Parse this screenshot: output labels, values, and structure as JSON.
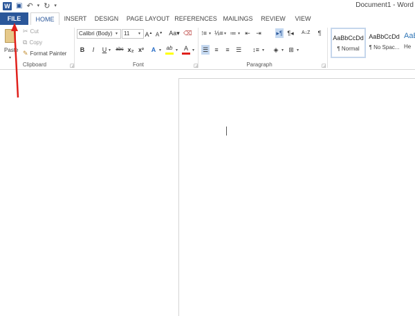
{
  "app": {
    "title": "Document1 - Word",
    "logo_letter": "W"
  },
  "quick_access": {
    "save": "💾",
    "undo": "↶",
    "undo_more": "▾",
    "redo": "↻",
    "customize": "▾"
  },
  "tabs": [
    {
      "label": "FILE",
      "key": "file"
    },
    {
      "label": "HOME",
      "key": "home"
    },
    {
      "label": "INSERT",
      "key": "insert"
    },
    {
      "label": "DESIGN",
      "key": "design"
    },
    {
      "label": "PAGE LAYOUT",
      "key": "page-layout"
    },
    {
      "label": "REFERENCES",
      "key": "references"
    },
    {
      "label": "MAILINGS",
      "key": "mailings"
    },
    {
      "label": "REVIEW",
      "key": "review"
    },
    {
      "label": "VIEW",
      "key": "view"
    }
  ],
  "clipboard": {
    "paste_label": "Paste",
    "cut_label": "Cut",
    "copy_label": "Copy",
    "format_painter_label": "Format Painter",
    "group_label": "Clipboard"
  },
  "font": {
    "font_name": "Calibri (Body)",
    "font_size": "11",
    "grow": "A",
    "shrink": "A",
    "change_case": "Aa",
    "bold": "B",
    "italic": "I",
    "underline": "U",
    "strike": "abc",
    "subscript": "x₂",
    "superscript": "x²",
    "text_effects": "A",
    "highlight": "ab",
    "font_color": "A",
    "group_label": "Font"
  },
  "paragraph": {
    "sort": "A↓Z",
    "pilcrow": "¶",
    "group_label": "Paragraph"
  },
  "styles": [
    {
      "sample": "AaBbCcDd",
      "name": "¶ Normal",
      "selected": true
    },
    {
      "sample": "AaBbCcDd",
      "name": "¶ No Spac...",
      "selected": false
    },
    {
      "sample": "AaBbC",
      "name": "He",
      "selected": false
    }
  ],
  "colors": {
    "accent": "#2b579a",
    "annotation_arrow": "#e0201b",
    "font_color_bar": "#e0201b",
    "highlight_bar": "#ffff00"
  }
}
